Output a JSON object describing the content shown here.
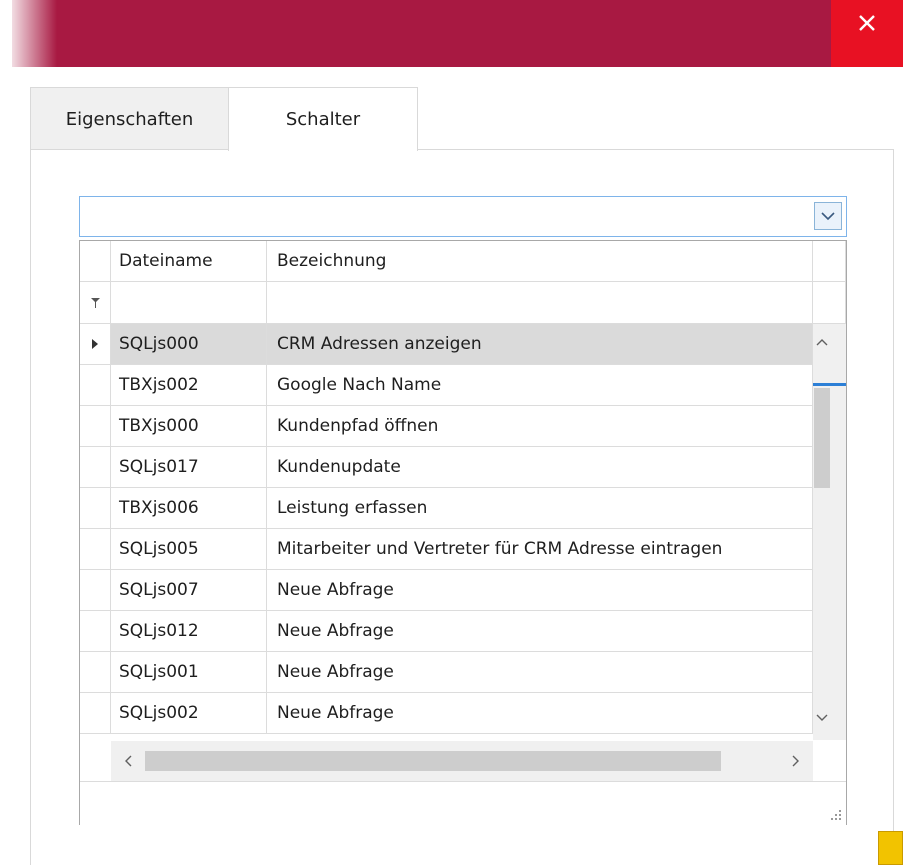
{
  "window": {
    "close_icon": "close-icon"
  },
  "tabs": [
    {
      "label": "Eigenschaften",
      "active": false
    },
    {
      "label": "Schalter",
      "active": true
    }
  ],
  "combo": {
    "value": "",
    "dropdown_icon": "chevron-down-icon"
  },
  "grid": {
    "columns": [
      "Dateiname",
      "Bezeichnung"
    ],
    "filter_icon": "filter-icon",
    "rows": [
      {
        "dateiname": "SQLjs000",
        "bezeichnung": "CRM Adressen anzeigen",
        "selected": true
      },
      {
        "dateiname": "TBXjs002",
        "bezeichnung": "Google Nach Name"
      },
      {
        "dateiname": "TBXjs000",
        "bezeichnung": "Kundenpfad öffnen"
      },
      {
        "dateiname": "SQLjs017",
        "bezeichnung": "Kundenupdate"
      },
      {
        "dateiname": "TBXjs006",
        "bezeichnung": "Leistung erfassen"
      },
      {
        "dateiname": "SQLjs005",
        "bezeichnung": "Mitarbeiter und Vertreter für CRM Adresse eintragen"
      },
      {
        "dateiname": "SQLjs007",
        "bezeichnung": "Neue Abfrage"
      },
      {
        "dateiname": "SQLjs012",
        "bezeichnung": "Neue Abfrage"
      },
      {
        "dateiname": "SQLjs001",
        "bezeichnung": "Neue Abfrage"
      },
      {
        "dateiname": "SQLjs002",
        "bezeichnung": "Neue Abfrage"
      }
    ]
  },
  "colors": {
    "titlebar": "#a81942",
    "close_button": "#e81123",
    "selection": "#dadada",
    "accent": "#2c7fd6"
  }
}
